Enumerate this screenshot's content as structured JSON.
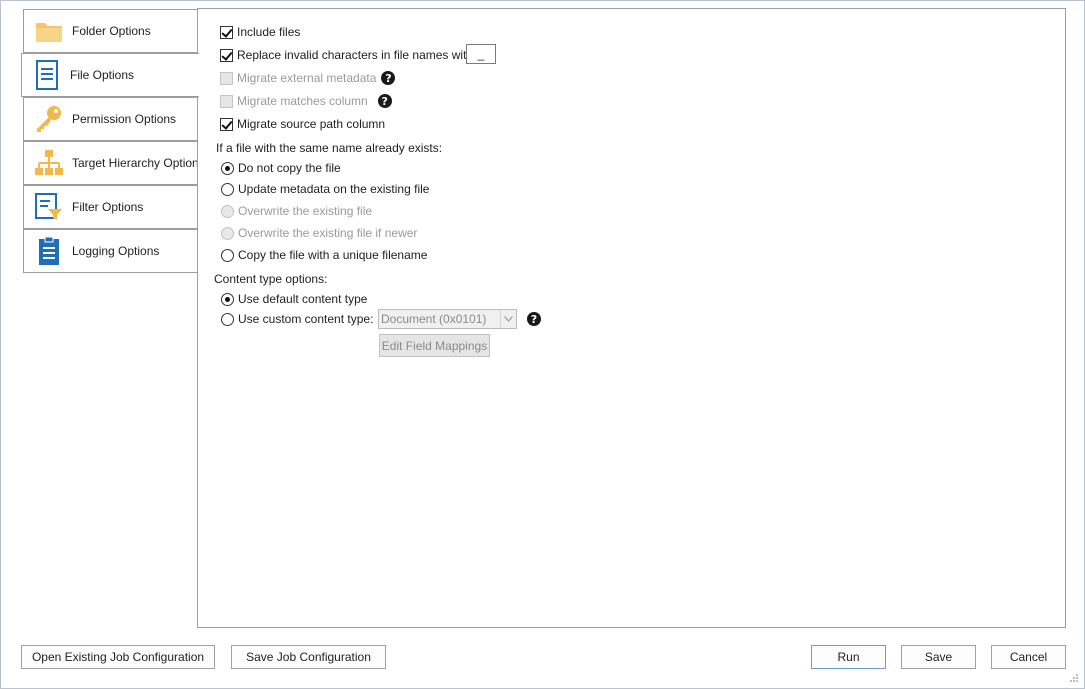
{
  "tabs": [
    {
      "label": "Folder Options",
      "icon": "folder-icon"
    },
    {
      "label": "File Options",
      "icon": "file-icon"
    },
    {
      "label": "Permission Options",
      "icon": "key-icon"
    },
    {
      "label": "Target Hierarchy Options",
      "icon": "hierarchy-icon"
    },
    {
      "label": "Filter Options",
      "icon": "filter-icon"
    },
    {
      "label": "Logging Options",
      "icon": "clipboard-icon"
    }
  ],
  "active_tab": "File Options",
  "options": {
    "include_files": {
      "label": "Include files",
      "checked": true
    },
    "replace_invalid": {
      "label": "Replace invalid characters in file names with:",
      "checked": true,
      "value": "_"
    },
    "migrate_external_metadata": {
      "label": "Migrate external metadata",
      "checked": false,
      "disabled": true
    },
    "migrate_matches_column": {
      "label": "Migrate matches column",
      "checked": false,
      "disabled": true
    },
    "migrate_source_path": {
      "label": "Migrate source path column",
      "checked": true
    }
  },
  "existing_file": {
    "heading": "If a file with the same name already exists:",
    "choices": [
      {
        "label": "Do not copy the file",
        "selected": true,
        "disabled": false
      },
      {
        "label": "Update metadata on the existing file",
        "selected": false,
        "disabled": false
      },
      {
        "label": "Overwrite the existing file",
        "selected": false,
        "disabled": true
      },
      {
        "label": "Overwrite the existing file if newer",
        "selected": false,
        "disabled": true
      },
      {
        "label": "Copy the file with a unique filename",
        "selected": false,
        "disabled": false
      }
    ]
  },
  "content_type": {
    "heading": "Content type options:",
    "default_label": "Use default content type",
    "custom_label": "Use custom content type:",
    "selected": "default",
    "combo_value": "Document (0x0101)",
    "edit_mappings": "Edit Field Mappings"
  },
  "footer": {
    "open_config": "Open Existing Job Configuration",
    "save_config": "Save Job Configuration",
    "run": "Run",
    "save": "Save",
    "cancel": "Cancel"
  },
  "help_glyph": "?"
}
